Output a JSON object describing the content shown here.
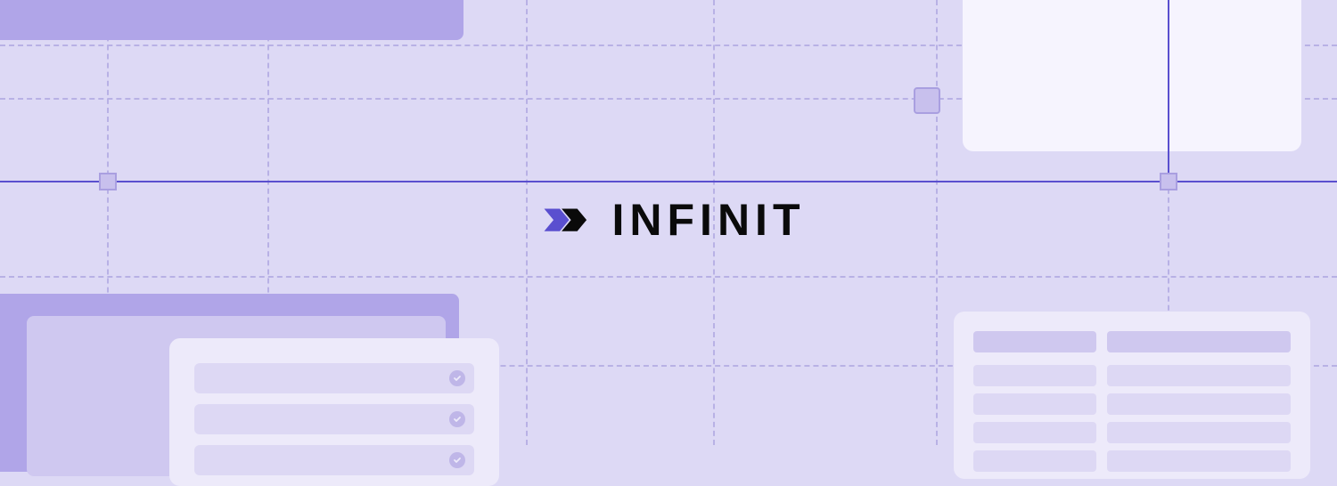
{
  "brand": {
    "name": "INFINIT",
    "accent_color": "#5A4FCF",
    "text_color": "#0A0A0A",
    "background_color": "#DDD9F5"
  }
}
